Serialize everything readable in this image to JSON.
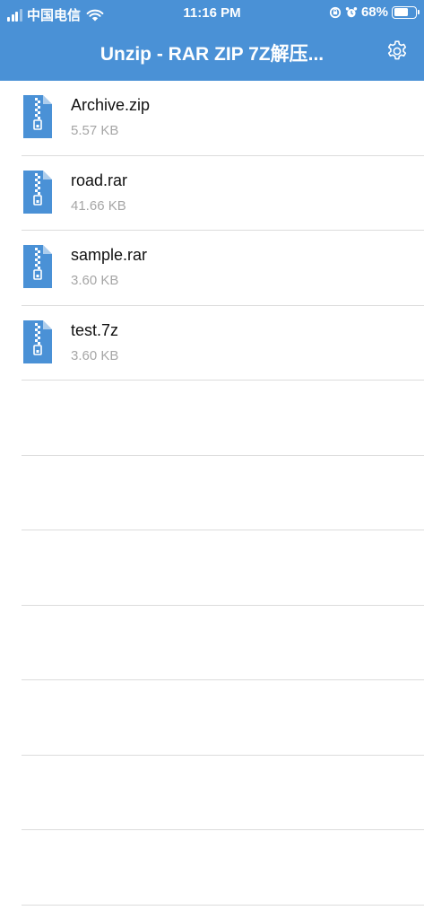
{
  "status": {
    "carrier": "中国电信",
    "time": "11:16 PM",
    "battery": "68%",
    "battery_level": 0.68
  },
  "header": {
    "title": "Unzip - RAR ZIP 7Z解压..."
  },
  "files": [
    {
      "name": "Archive.zip",
      "size": "5.57 KB"
    },
    {
      "name": "road.rar",
      "size": "41.66 KB"
    },
    {
      "name": "sample.rar",
      "size": "3.60 KB"
    },
    {
      "name": "test.7z",
      "size": "3.60 KB"
    }
  ],
  "empty_rows": 7,
  "colors": {
    "header_bg": "#4a91d6",
    "icon": "#4a91d6",
    "separator": "#dcdcdc",
    "secondary_text": "#a6a6a6"
  },
  "icons": {
    "file": "zip-file-icon",
    "settings": "gear-icon"
  }
}
